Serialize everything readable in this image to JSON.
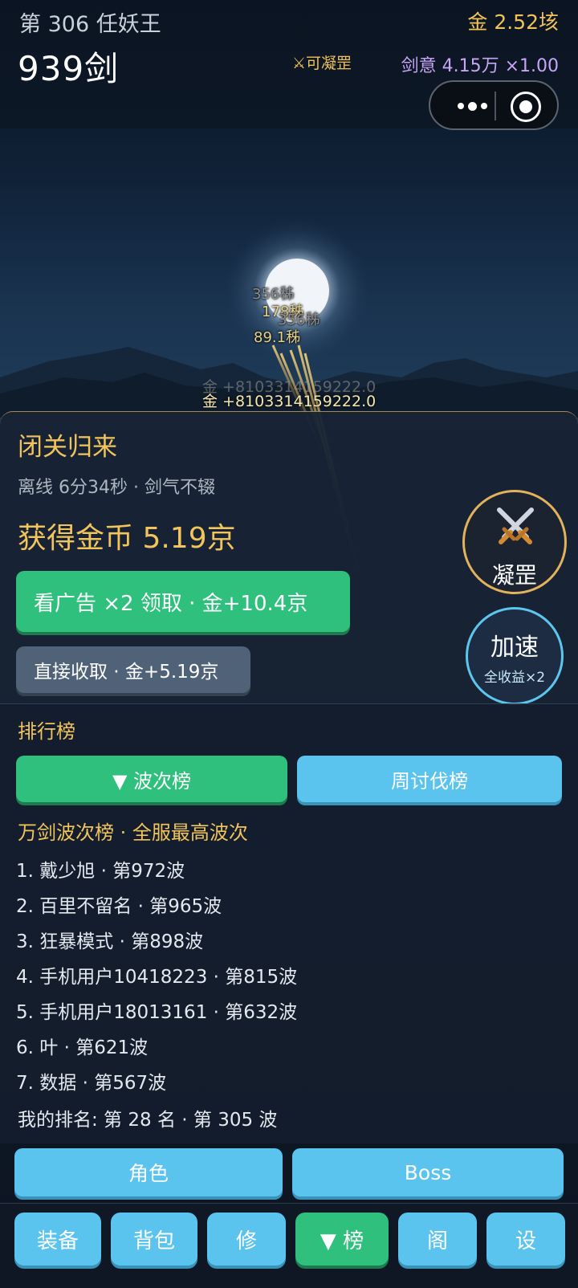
{
  "header": {
    "wave_label": "第 306 任妖王",
    "gold": "金 2.52垓",
    "sword_count": "939剑",
    "condense_tag": "⚔可凝罡",
    "sword_intent": "剑意 4.15万 ×1.00"
  },
  "capsule": {
    "more_icon": "more-dots-icon",
    "close_icon": "target-circle-icon"
  },
  "battle": {
    "damage_numbers": [
      "356秭",
      "178秭",
      "356秭",
      "89.1秭"
    ],
    "gold_gain": "金 +8103314159222.0",
    "gold_gain_ghost": "金 +8103314159222.0"
  },
  "offline": {
    "title": "闭关归来",
    "subtitle": "离线 6分34秒 · 剑气不辍",
    "gain": "获得金币 5.19京",
    "ad_button": "看广告 ×2 领取 · 金+10.4京",
    "collect_button": "直接收取 · 金+5.19京"
  },
  "side_buttons": {
    "condense": "凝罡",
    "condense_icon": "crossed-swords-icon",
    "speed": "加速",
    "speed_sub": "全收益×2"
  },
  "rankings": {
    "title": "排行榜",
    "tabs": [
      "▼ 波次榜",
      "周讨伐榜"
    ],
    "subtitle": "万剑波次榜 · 全服最高波次",
    "entries": [
      "1. 戴少旭 · 第972波",
      "2. 百里不留名 · 第965波",
      "3. 狂暴模式 · 第898波",
      " 4. 手机用户10418223 · 第815波",
      "5. 手机用户18013161 · 第632波",
      "6. 叶 · 第621波",
      " 7. 数据 · 第567波"
    ],
    "my_rank": "我的排名: 第 28 名 · 第 305 波"
  },
  "actions": {
    "role": "角色",
    "boss": "Boss"
  },
  "nav": [
    "装备",
    "背包",
    "修",
    "▼ 榜",
    "阁",
    "设"
  ],
  "colors": {
    "gold": "#f2c45c",
    "green": "#2ec07c",
    "blue": "#5bc4ee",
    "purple": "#c6a6f5"
  }
}
